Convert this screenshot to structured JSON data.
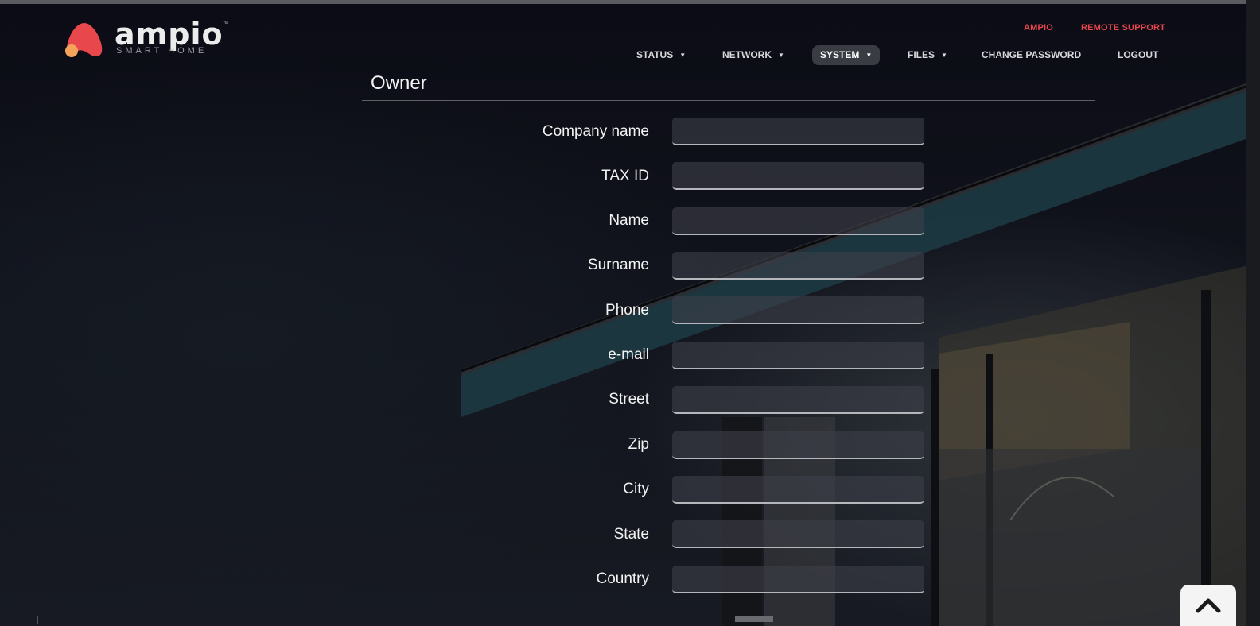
{
  "header": {
    "logo": {
      "word": "ampio",
      "tagline": "SMART HOME",
      "tm": "™"
    },
    "top_links": [
      "AMPIO",
      "REMOTE SUPPORT"
    ],
    "nav": [
      {
        "label": "STATUS",
        "caret": "▼"
      },
      {
        "label": "NETWORK",
        "caret": "▼"
      },
      {
        "label": "SYSTEM",
        "caret": "▼",
        "active": true
      },
      {
        "label": "FILES",
        "caret": "▼"
      },
      {
        "label": "CHANGE PASSWORD"
      },
      {
        "label": "LOGOUT"
      }
    ]
  },
  "section": {
    "title": "Owner",
    "fields": [
      {
        "label": "Company name",
        "value": ""
      },
      {
        "label": "TAX ID",
        "value": ""
      },
      {
        "label": "Name",
        "value": ""
      },
      {
        "label": "Surname",
        "value": ""
      },
      {
        "label": "Phone",
        "value": ""
      },
      {
        "label": "e-mail",
        "value": ""
      },
      {
        "label": "Street",
        "value": ""
      },
      {
        "label": "Zip",
        "value": ""
      },
      {
        "label": "City",
        "value": ""
      },
      {
        "label": "State",
        "value": ""
      },
      {
        "label": "Country",
        "value": ""
      }
    ]
  },
  "colors": {
    "accent": "#e8474c",
    "logo_orange": "#f4a45a",
    "background": "#0e0f17"
  },
  "icons": {
    "scroll_top": "chevron-up-icon"
  }
}
